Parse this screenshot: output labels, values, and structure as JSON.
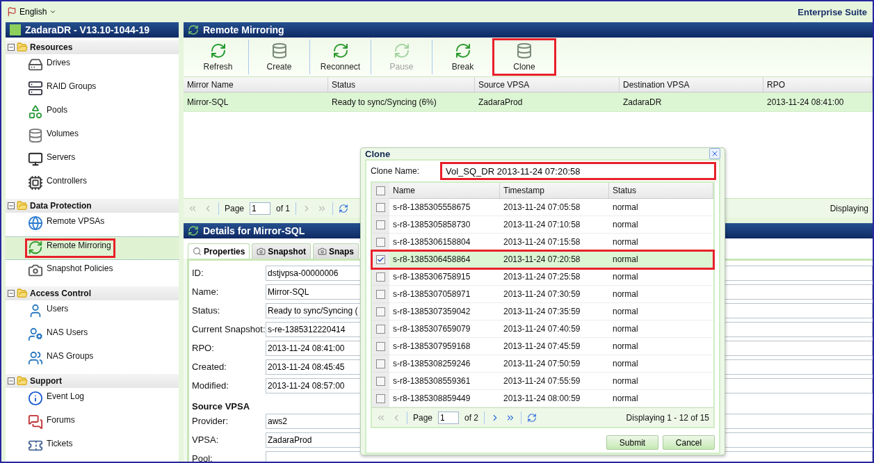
{
  "top_bar": {
    "language": "English",
    "product": "Enterprise Suite"
  },
  "sidebar": {
    "title": "ZadaraDR - V13.10-1044-19",
    "sections": [
      {
        "title": "Resources",
        "expanded": true,
        "items": [
          {
            "label": "Drives",
            "selected": false,
            "highlighted": false
          },
          {
            "label": "RAID Groups",
            "selected": false,
            "highlighted": false
          },
          {
            "label": "Pools",
            "selected": false,
            "highlighted": false
          },
          {
            "label": "Volumes",
            "selected": false,
            "highlighted": false
          },
          {
            "label": "Servers",
            "selected": false,
            "highlighted": false
          },
          {
            "label": "Controllers",
            "selected": false,
            "highlighted": false
          }
        ]
      },
      {
        "title": "Data Protection",
        "expanded": true,
        "items": [
          {
            "label": "Remote VPSAs",
            "selected": false,
            "highlighted": false
          },
          {
            "label": "Remote Mirroring",
            "selected": true,
            "highlighted": true
          },
          {
            "label": "Snapshot Policies",
            "selected": false,
            "highlighted": false
          }
        ]
      },
      {
        "title": "Access Control",
        "expanded": true,
        "items": [
          {
            "label": "Users",
            "selected": false,
            "highlighted": false
          },
          {
            "label": "NAS Users",
            "selected": false,
            "highlighted": false
          },
          {
            "label": "NAS Groups",
            "selected": false,
            "highlighted": false
          }
        ]
      },
      {
        "title": "Support",
        "expanded": true,
        "items": [
          {
            "label": "Event Log",
            "selected": false,
            "highlighted": false
          },
          {
            "label": "Forums",
            "selected": false,
            "highlighted": false
          },
          {
            "label": "Tickets",
            "selected": false,
            "highlighted": false
          }
        ]
      }
    ]
  },
  "mirroring": {
    "title": "Remote Mirroring",
    "toolbar": [
      {
        "label": "Refresh",
        "disabled": false,
        "highlighted": false
      },
      {
        "label": "Create",
        "disabled": false,
        "highlighted": false
      },
      {
        "label": "Reconnect",
        "disabled": false,
        "highlighted": false
      },
      {
        "label": "Pause",
        "disabled": true,
        "highlighted": false
      },
      {
        "label": "Break",
        "disabled": false,
        "highlighted": false
      },
      {
        "label": "Clone",
        "disabled": false,
        "highlighted": true
      }
    ],
    "columns": [
      "Mirror Name",
      "Status",
      "Source VPSA",
      "Destination VPSA",
      "RPO"
    ],
    "rows": [
      {
        "cells": [
          "Mirror-SQL",
          "Ready to sync/Syncing (6%)",
          "ZadaraProd",
          "ZadaraDR",
          "2013-11-24 08:41:00"
        ],
        "selected": true
      }
    ],
    "pager": {
      "page_label": "Page",
      "page": "1",
      "page_count": "of 1",
      "displaying": "Displaying"
    }
  },
  "details": {
    "title": "Details for Mirror-SQL",
    "tabs": [
      {
        "label": "Properties",
        "selected": true
      },
      {
        "label": "Snapshot",
        "selected": false
      },
      {
        "label": "Snaps",
        "selected": false
      }
    ],
    "fields": [
      {
        "kind": "field",
        "label": "ID:",
        "value": "dstjvpsa-00000006"
      },
      {
        "kind": "field",
        "label": "Name:",
        "value": "Mirror-SQL"
      },
      {
        "kind": "field",
        "label": "Status:",
        "value": "Ready to sync/Syncing ("
      },
      {
        "kind": "field",
        "label": "Current Snapshot:",
        "value": "s-re-1385312220414"
      },
      {
        "kind": "field",
        "label": "RPO:",
        "value": "2013-11-24 08:41:00"
      },
      {
        "kind": "field",
        "label": "Created:",
        "value": "2013-11-24 08:45:45"
      },
      {
        "kind": "field",
        "label": "Modified:",
        "value": "2013-11-24 08:57:00"
      },
      {
        "kind": "heading",
        "label": "Source VPSA"
      },
      {
        "kind": "field",
        "label": "Provider:",
        "value": "aws2"
      },
      {
        "kind": "field",
        "label": "VPSA:",
        "value": "ZadaraProd"
      },
      {
        "kind": "field",
        "label": "Pool:"
      }
    ]
  },
  "clone_dialog": {
    "title": "Clone",
    "name_label": "Clone Name:",
    "name_value": "Vol_SQ_DR 2013-11-24 07:20:58",
    "name_highlighted": true,
    "select_all": false,
    "columns": [
      "Name",
      "Timestamp",
      "Status"
    ],
    "rows": [
      {
        "name": "s-r8-1385305558675",
        "timestamp": "2013-11-24 07:05:58",
        "status": "normal",
        "checked": false,
        "selected": false,
        "highlighted": false
      },
      {
        "name": "s-r8-1385305858730",
        "timestamp": "2013-11-24 07:10:58",
        "status": "normal",
        "checked": false,
        "selected": false,
        "highlighted": false
      },
      {
        "name": "s-r8-1385306158804",
        "timestamp": "2013-11-24 07:15:58",
        "status": "normal",
        "checked": false,
        "selected": false,
        "highlighted": false
      },
      {
        "name": "s-r8-1385306458864",
        "timestamp": "2013-11-24 07:20:58",
        "status": "normal",
        "checked": true,
        "selected": true,
        "highlighted": true
      },
      {
        "name": "s-r8-1385306758915",
        "timestamp": "2013-11-24 07:25:58",
        "status": "normal",
        "checked": false,
        "selected": false,
        "highlighted": false
      },
      {
        "name": "s-r8-1385307058971",
        "timestamp": "2013-11-24 07:30:59",
        "status": "normal",
        "checked": false,
        "selected": false,
        "highlighted": false
      },
      {
        "name": "s-r8-1385307359042",
        "timestamp": "2013-11-24 07:35:59",
        "status": "normal",
        "checked": false,
        "selected": false,
        "highlighted": false
      },
      {
        "name": "s-r8-1385307659079",
        "timestamp": "2013-11-24 07:40:59",
        "status": "normal",
        "checked": false,
        "selected": false,
        "highlighted": false
      },
      {
        "name": "s-r8-1385307959168",
        "timestamp": "2013-11-24 07:45:59",
        "status": "normal",
        "checked": false,
        "selected": false,
        "highlighted": false
      },
      {
        "name": "s-r8-1385308259246",
        "timestamp": "2013-11-24 07:50:59",
        "status": "normal",
        "checked": false,
        "selected": false,
        "highlighted": false
      },
      {
        "name": "s-r8-1385308559361",
        "timestamp": "2013-11-24 07:55:59",
        "status": "normal",
        "checked": false,
        "selected": false,
        "highlighted": false
      },
      {
        "name": "s-r8-1385308859449",
        "timestamp": "2013-11-24 08:00:59",
        "status": "normal",
        "checked": false,
        "selected": false,
        "highlighted": false
      }
    ],
    "pager": {
      "page_label": "Page",
      "page": "1",
      "page_count": "of 2",
      "displaying": "Displaying 1 - 12 of 15"
    },
    "buttons": [
      "Submit",
      "Cancel"
    ]
  }
}
